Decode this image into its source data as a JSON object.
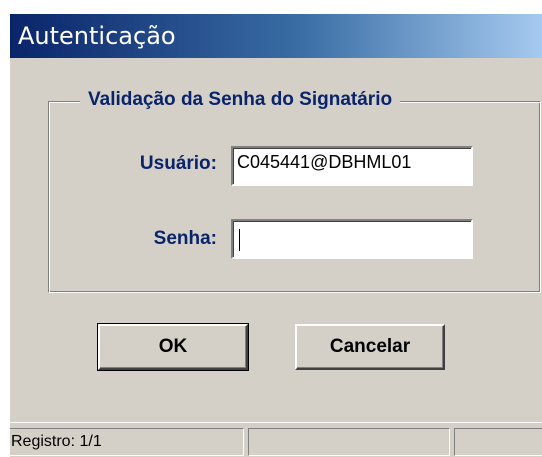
{
  "window": {
    "title": "Autenticação"
  },
  "group": {
    "legend": "Validação da Senha do Signatário"
  },
  "form": {
    "user_label": "Usuário:",
    "user_value": "C045441@DBHML01",
    "password_label": "Senha:",
    "password_value": ""
  },
  "buttons": {
    "ok_label": "OK",
    "cancel_label": "Cancelar"
  },
  "statusbar": {
    "record_text": "Registro: 1/1",
    "panel2_text": "",
    "panel3_text": ""
  }
}
